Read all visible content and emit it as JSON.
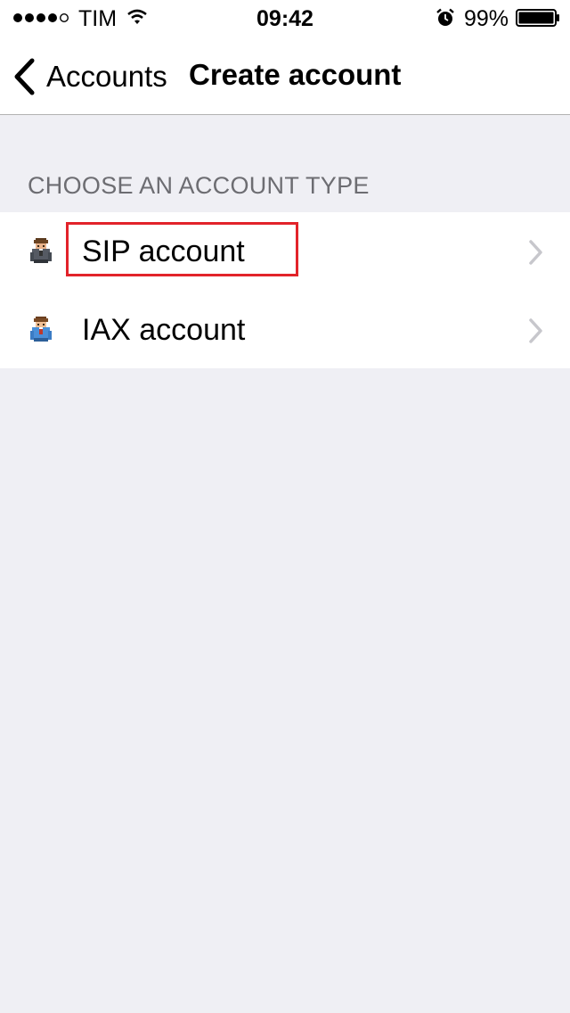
{
  "status_bar": {
    "carrier": "TIM",
    "time": "09:42",
    "battery_percent": "99%",
    "signal_bars": 4,
    "signal_total": 5
  },
  "nav": {
    "back_label": "Accounts",
    "title": "Create account"
  },
  "section": {
    "header": "CHOOSE AN ACCOUNT TYPE"
  },
  "rows": [
    {
      "label": "SIP account",
      "icon": "sip-user-icon",
      "highlighted": true
    },
    {
      "label": "IAX account",
      "icon": "iax-user-icon",
      "highlighted": false
    }
  ],
  "colors": {
    "background": "#efeff4",
    "highlight": "#e2232a",
    "chevron": "#c7c7cc",
    "section_header": "#6d6d72"
  }
}
